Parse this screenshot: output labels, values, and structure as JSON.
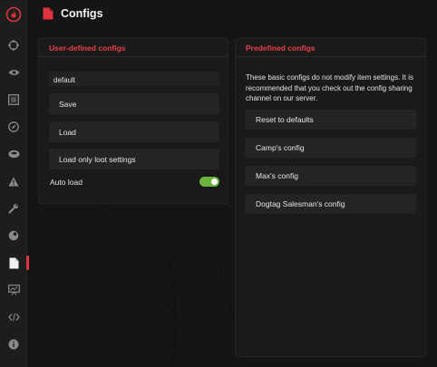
{
  "colors": {
    "accent": "#e0343f",
    "toggle_on": "#6db33f"
  },
  "sidebar": {
    "logo_icon": "flame-icon",
    "items": [
      {
        "icon": "crosshair-icon",
        "active": false
      },
      {
        "icon": "eye-icon",
        "active": false
      },
      {
        "icon": "list-box-icon",
        "active": false
      },
      {
        "icon": "compass-icon",
        "active": false
      },
      {
        "icon": "disc-icon",
        "active": false
      },
      {
        "icon": "warning-icon",
        "active": false
      },
      {
        "icon": "wrench-icon",
        "active": false
      },
      {
        "icon": "palette-icon",
        "active": false
      },
      {
        "icon": "document-icon",
        "active": true
      },
      {
        "icon": "chart-board-icon",
        "active": false
      },
      {
        "icon": "code-icon",
        "active": false
      },
      {
        "icon": "info-icon",
        "active": false
      }
    ]
  },
  "header": {
    "title": "Configs",
    "icon": "document-icon"
  },
  "user_configs": {
    "title": "User-defined configs",
    "name_value": "default",
    "save_label": "Save",
    "load_label": "Load",
    "load_loot_label": "Load only loot settings",
    "auto_load_label": "Auto load",
    "auto_load_on": true
  },
  "predefined_configs": {
    "title": "Predefined configs",
    "description": "These basic configs do not modify item settings. It is recommended that you check out the config sharing channel on our server.",
    "items": [
      "Reset to defaults",
      "Camp's config",
      "Max's config",
      "Dogtag Salesman's config"
    ]
  }
}
